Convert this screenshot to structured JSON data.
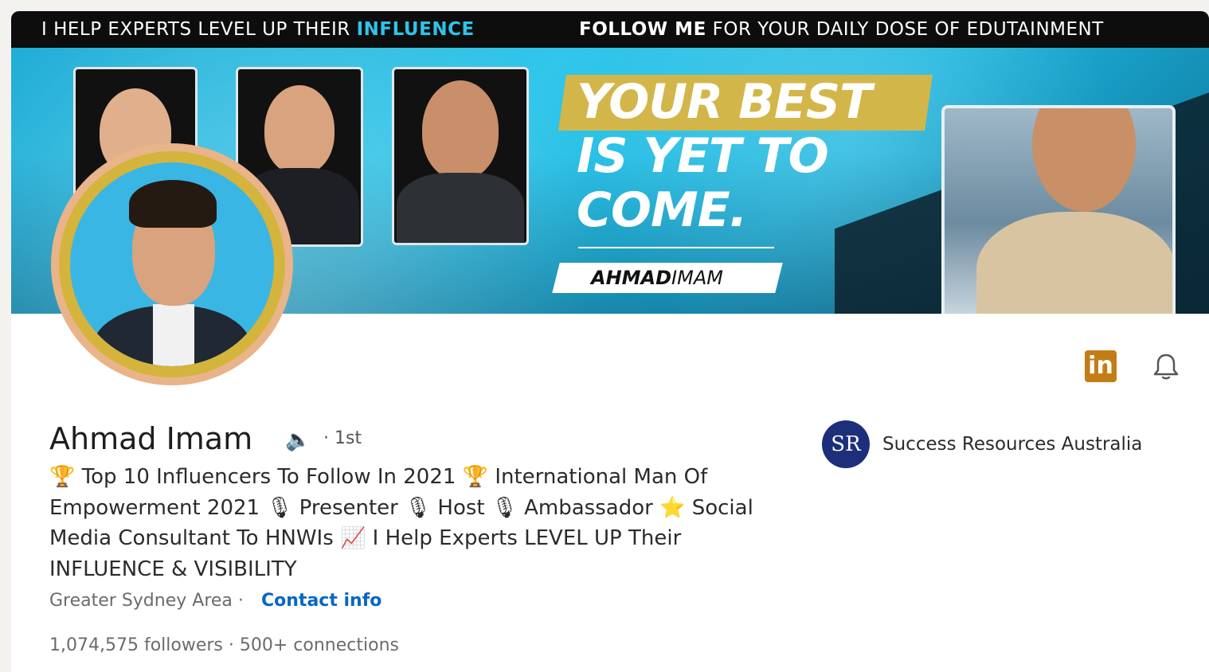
{
  "banner": {
    "tagline_part1": "I HELP EXPERTS LEVEL UP THEIR ",
    "tagline_highlight": "INFLUENCE",
    "tagline_bold": "FOLLOW ME",
    "tagline_part2": " FOR YOUR DAILY DOSE OF EDUTAINMENT",
    "headline_line1": "YOUR BEST",
    "headline_line2": "IS YET TO",
    "headline_line3": "COME.",
    "name_bold": "AHMAD",
    "name_rest": "IMAM"
  },
  "profile": {
    "name": "Ahmad Imam",
    "speaker_icon": "speaker-icon",
    "degree": "· 1st",
    "headline": "🏆 Top 10 Influencers To Follow In 2021 🏆 International Man Of Empowerment 2021 🎙 Presenter 🎙 Host 🎙 Ambassador ⭐ Social Media Consultant To HNWIs 📈 I Help Experts LEVEL UP Their INFLUENCE & VISIBILITY",
    "location": "Greater Sydney Area ·",
    "contact_label": "Contact info",
    "followers": "1,074,575 followers",
    "connections": "· 500+ connections"
  },
  "company": {
    "logo_text": "SR",
    "name": "Success Resources Australia"
  },
  "actions": {
    "linkedin_icon_text": "in",
    "bell_icon": "bell-icon"
  },
  "colors": {
    "linkedin_brand": "#c37d16",
    "link_blue": "#0a66c2",
    "influence_cyan": "#2fc3ea",
    "avatar_gold": "#d4b43c"
  }
}
